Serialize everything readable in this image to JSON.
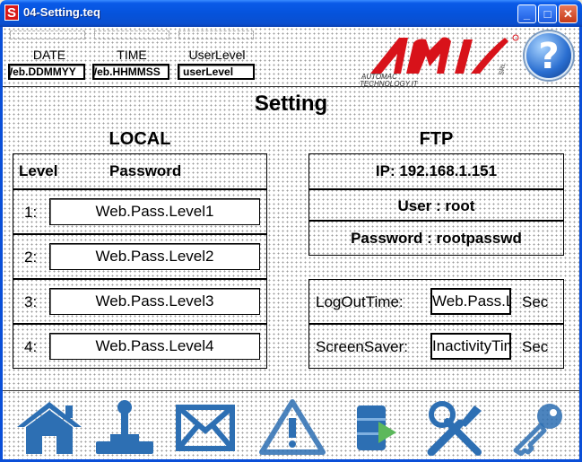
{
  "window": {
    "app_icon_letter": "S",
    "title": "04-Setting.teq",
    "minimize": "_",
    "maximize": "□",
    "close": "✕"
  },
  "header": {
    "date_label": "DATE",
    "date_value": "Web.DDMMYY",
    "time_label": "TIME",
    "time_value": "Web.HHMMSS",
    "userlevel_label": "UserLevel",
    "userlevel_value": "userLevel",
    "logo_text_line1": "AUTOMAC",
    "logo_text_line2": "TECHNOLOGY.IT",
    "logo_side": "SRL",
    "help_glyph": "?"
  },
  "page_title": "Setting",
  "local": {
    "title": "LOCAL",
    "col_level": "Level",
    "col_password": "Password",
    "rows": [
      {
        "level": "1:",
        "password": "Web.Pass.Level1"
      },
      {
        "level": "2:",
        "password": "Web.Pass.Level2"
      },
      {
        "level": "3:",
        "password": "Web.Pass.Level3"
      },
      {
        "level": "4:",
        "password": "Web.Pass.Level4"
      }
    ]
  },
  "ftp": {
    "title": "FTP",
    "ip": "IP: 192.168.1.151",
    "user": "User : root",
    "password": "Password : rootpasswd"
  },
  "timeouts": {
    "logout_label": "LogOutTime:",
    "logout_value": "Web.Pass.Logout",
    "logout_unit": "Sec",
    "screensaver_label": "ScreenSaver:",
    "screensaver_value": "InactivityTime",
    "screensaver_unit": "Sec"
  },
  "nav": [
    {
      "name": "home-icon"
    },
    {
      "name": "joystick-icon"
    },
    {
      "name": "mail-icon"
    },
    {
      "name": "warning-icon"
    },
    {
      "name": "database-export-icon"
    },
    {
      "name": "tools-icon"
    },
    {
      "name": "key-icon"
    }
  ],
  "colors": {
    "titlebar": "#0553dc",
    "logo_red": "#d8121a",
    "icon_blue": "#2d6fb3"
  }
}
